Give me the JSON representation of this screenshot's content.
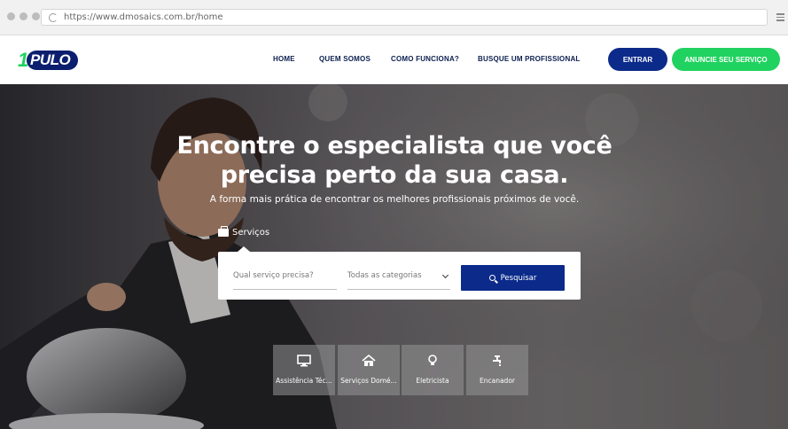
{
  "browser": {
    "url": "https://www.dmosaics.com.br/home"
  },
  "header": {
    "logo_text": "1PULO",
    "nav": [
      {
        "label": "HOME"
      },
      {
        "label": "QUEM SOMOS"
      },
      {
        "label": "COMO FUNCIONA?"
      },
      {
        "label": "BUSQUE UM PROFISSIONAL"
      }
    ],
    "login_label": "ENTRAR",
    "cta_label": "ANUNCIE SEU SERVIÇO"
  },
  "hero": {
    "headline_line1": "Encontre o especialista que você",
    "headline_line2": "precisa perto da sua casa.",
    "subheadline": "A forma mais prática de encontrar os melhores profissionais próximos de você.",
    "tab_label": "Serviços",
    "search": {
      "service_placeholder": "Qual serviço precisa?",
      "category_selected": "Todas as categorias",
      "button_label": "Pesquisar"
    },
    "categories": [
      {
        "label": "Assistência Téc...",
        "icon": "monitor-icon"
      },
      {
        "label": "Serviços Domé...",
        "icon": "house-icon"
      },
      {
        "label": "Eletricista",
        "icon": "lightbulb-icon"
      },
      {
        "label": "Encanador",
        "icon": "faucet-icon"
      }
    ]
  },
  "colors": {
    "brand_navy": "#0b2a8a",
    "brand_green": "#20d25f",
    "nav_text": "#0b1f4f"
  }
}
